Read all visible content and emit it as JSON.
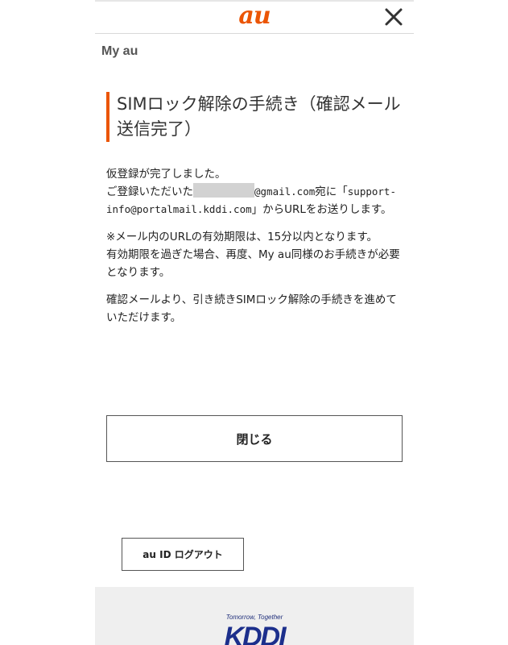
{
  "header": {
    "logo": "au",
    "close_icon": "close-icon"
  },
  "breadcrumb": "My au",
  "page_title": "SIMロック解除の手続き（確認メール送信完了）",
  "body": {
    "p1_line1": "仮登録が完了しました。",
    "p1_line2_pre": "ご登録いただいた",
    "p1_masked_email_domain": "@gmail.com",
    "p1_line2_mid": "宛に「",
    "p1_sender_email": "support-info@portalmail.kddi.com",
    "p1_line2_post": "」からURLをお送りします。",
    "p2_line1": "※メール内のURLの有効期限は、15分以内となります。",
    "p2_line2": "有効期限を過ぎた場合、再度、My au同様のお手続きが必要となります。",
    "p3": "確認メールより、引き続きSIMロック解除の手続きを進めていただけます。"
  },
  "buttons": {
    "close_label": "閉じる",
    "logout_label": "au ID ログアウト"
  },
  "footer": {
    "tagline": "Tomorrow, Together",
    "logo": "KDDI"
  },
  "colors": {
    "brand_orange": "#eb5505",
    "kddi_blue": "#1c2f8c"
  }
}
